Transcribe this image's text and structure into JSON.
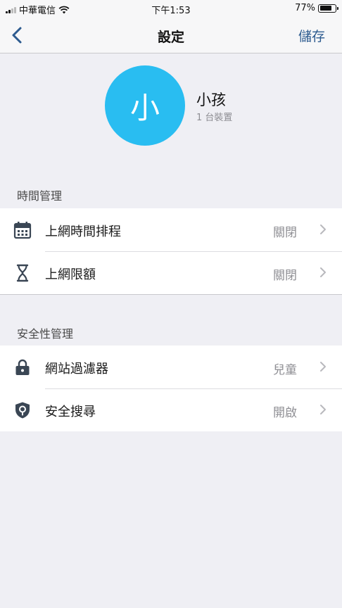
{
  "status_bar": {
    "carrier": "中華電信",
    "time": "下午1:53",
    "battery_percent": "77%",
    "battery_level": 0.77
  },
  "nav": {
    "back_icon": "chevron-left-icon",
    "title": "設定",
    "save_label": "儲存"
  },
  "profile": {
    "avatar_initial": "小",
    "avatar_color": "#29bdf1",
    "name": "小孩",
    "device_count": "1 台裝置"
  },
  "sections": [
    {
      "header": "時間管理",
      "items": [
        {
          "icon": "calendar-icon",
          "label": "上網時間排程",
          "value": "關閉"
        },
        {
          "icon": "hourglass-icon",
          "label": "上網限額",
          "value": "關閉"
        }
      ]
    },
    {
      "header": "安全性管理",
      "items": [
        {
          "icon": "lock-icon",
          "label": "網站過濾器",
          "value": "兒童"
        },
        {
          "icon": "shield-search-icon",
          "label": "安全搜尋",
          "value": "開啟"
        }
      ]
    }
  ],
  "colors": {
    "accent": "#2d5b8f",
    "background": "#efeff4",
    "icon": "#3a4654"
  }
}
